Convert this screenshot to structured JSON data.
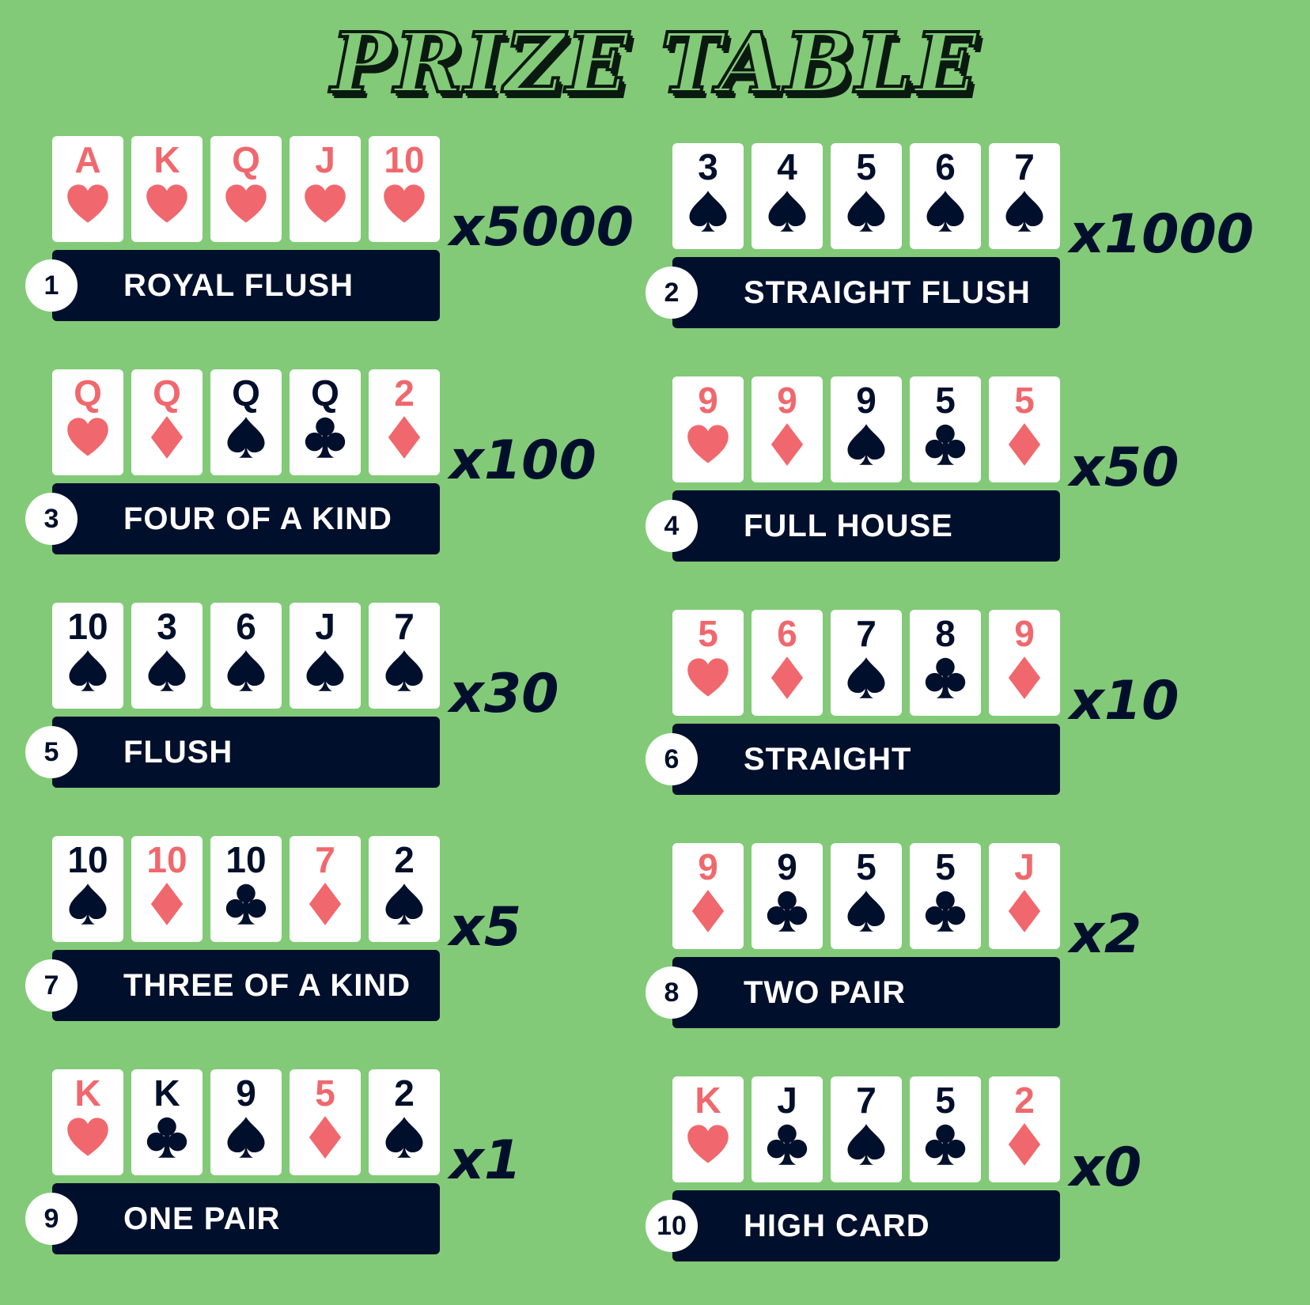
{
  "title": "PRIZE TABLE",
  "colors": {
    "background": "#82ca78",
    "bar": "#000f2b",
    "red_suit": "#f0686d",
    "black_suit": "#000f2b"
  },
  "hands": [
    {
      "rank_number": "1",
      "name": "ROYAL FLUSH",
      "multiplier": "x5000",
      "cards": [
        {
          "rank": "A",
          "suit": "hearts"
        },
        {
          "rank": "K",
          "suit": "hearts"
        },
        {
          "rank": "Q",
          "suit": "hearts"
        },
        {
          "rank": "J",
          "suit": "hearts"
        },
        {
          "rank": "10",
          "suit": "hearts"
        }
      ]
    },
    {
      "rank_number": "2",
      "name": "STRAIGHT FLUSH",
      "multiplier": "x1000",
      "cards": [
        {
          "rank": "3",
          "suit": "spades"
        },
        {
          "rank": "4",
          "suit": "spades"
        },
        {
          "rank": "5",
          "suit": "spades"
        },
        {
          "rank": "6",
          "suit": "spades"
        },
        {
          "rank": "7",
          "suit": "spades"
        }
      ]
    },
    {
      "rank_number": "3",
      "name": "FOUR OF A KIND",
      "multiplier": "x100",
      "cards": [
        {
          "rank": "Q",
          "suit": "hearts"
        },
        {
          "rank": "Q",
          "suit": "diamonds"
        },
        {
          "rank": "Q",
          "suit": "spades"
        },
        {
          "rank": "Q",
          "suit": "clubs"
        },
        {
          "rank": "2",
          "suit": "diamonds"
        }
      ]
    },
    {
      "rank_number": "4",
      "name": "FULL HOUSE",
      "multiplier": "x50",
      "cards": [
        {
          "rank": "9",
          "suit": "hearts"
        },
        {
          "rank": "9",
          "suit": "diamonds"
        },
        {
          "rank": "9",
          "suit": "spades"
        },
        {
          "rank": "5",
          "suit": "clubs"
        },
        {
          "rank": "5",
          "suit": "diamonds"
        }
      ]
    },
    {
      "rank_number": "5",
      "name": "FLUSH",
      "multiplier": "x30",
      "cards": [
        {
          "rank": "10",
          "suit": "spades"
        },
        {
          "rank": "3",
          "suit": "spades"
        },
        {
          "rank": "6",
          "suit": "spades"
        },
        {
          "rank": "J",
          "suit": "spades"
        },
        {
          "rank": "7",
          "suit": "spades"
        }
      ]
    },
    {
      "rank_number": "6",
      "name": "STRAIGHT",
      "multiplier": "x10",
      "cards": [
        {
          "rank": "5",
          "suit": "hearts"
        },
        {
          "rank": "6",
          "suit": "diamonds"
        },
        {
          "rank": "7",
          "suit": "spades"
        },
        {
          "rank": "8",
          "suit": "clubs"
        },
        {
          "rank": "9",
          "suit": "diamonds"
        }
      ]
    },
    {
      "rank_number": "7",
      "name": "THREE OF A KIND",
      "multiplier": "x5",
      "cards": [
        {
          "rank": "10",
          "suit": "spades"
        },
        {
          "rank": "10",
          "suit": "diamonds"
        },
        {
          "rank": "10",
          "suit": "clubs"
        },
        {
          "rank": "7",
          "suit": "diamonds"
        },
        {
          "rank": "2",
          "suit": "spades"
        }
      ]
    },
    {
      "rank_number": "8",
      "name": "TWO PAIR",
      "multiplier": "x2",
      "cards": [
        {
          "rank": "9",
          "suit": "diamonds"
        },
        {
          "rank": "9",
          "suit": "clubs"
        },
        {
          "rank": "5",
          "suit": "spades"
        },
        {
          "rank": "5",
          "suit": "clubs"
        },
        {
          "rank": "J",
          "suit": "diamonds"
        }
      ]
    },
    {
      "rank_number": "9",
      "name": "ONE PAIR",
      "multiplier": "x1",
      "cards": [
        {
          "rank": "K",
          "suit": "hearts"
        },
        {
          "rank": "K",
          "suit": "clubs"
        },
        {
          "rank": "9",
          "suit": "spades"
        },
        {
          "rank": "5",
          "suit": "diamonds"
        },
        {
          "rank": "2",
          "suit": "spades"
        }
      ]
    },
    {
      "rank_number": "10",
      "name": "HIGH CARD",
      "multiplier": "x0",
      "cards": [
        {
          "rank": "K",
          "suit": "hearts"
        },
        {
          "rank": "J",
          "suit": "clubs"
        },
        {
          "rank": "7",
          "suit": "spades"
        },
        {
          "rank": "5",
          "suit": "clubs"
        },
        {
          "rank": "2",
          "suit": "diamonds"
        }
      ]
    }
  ]
}
